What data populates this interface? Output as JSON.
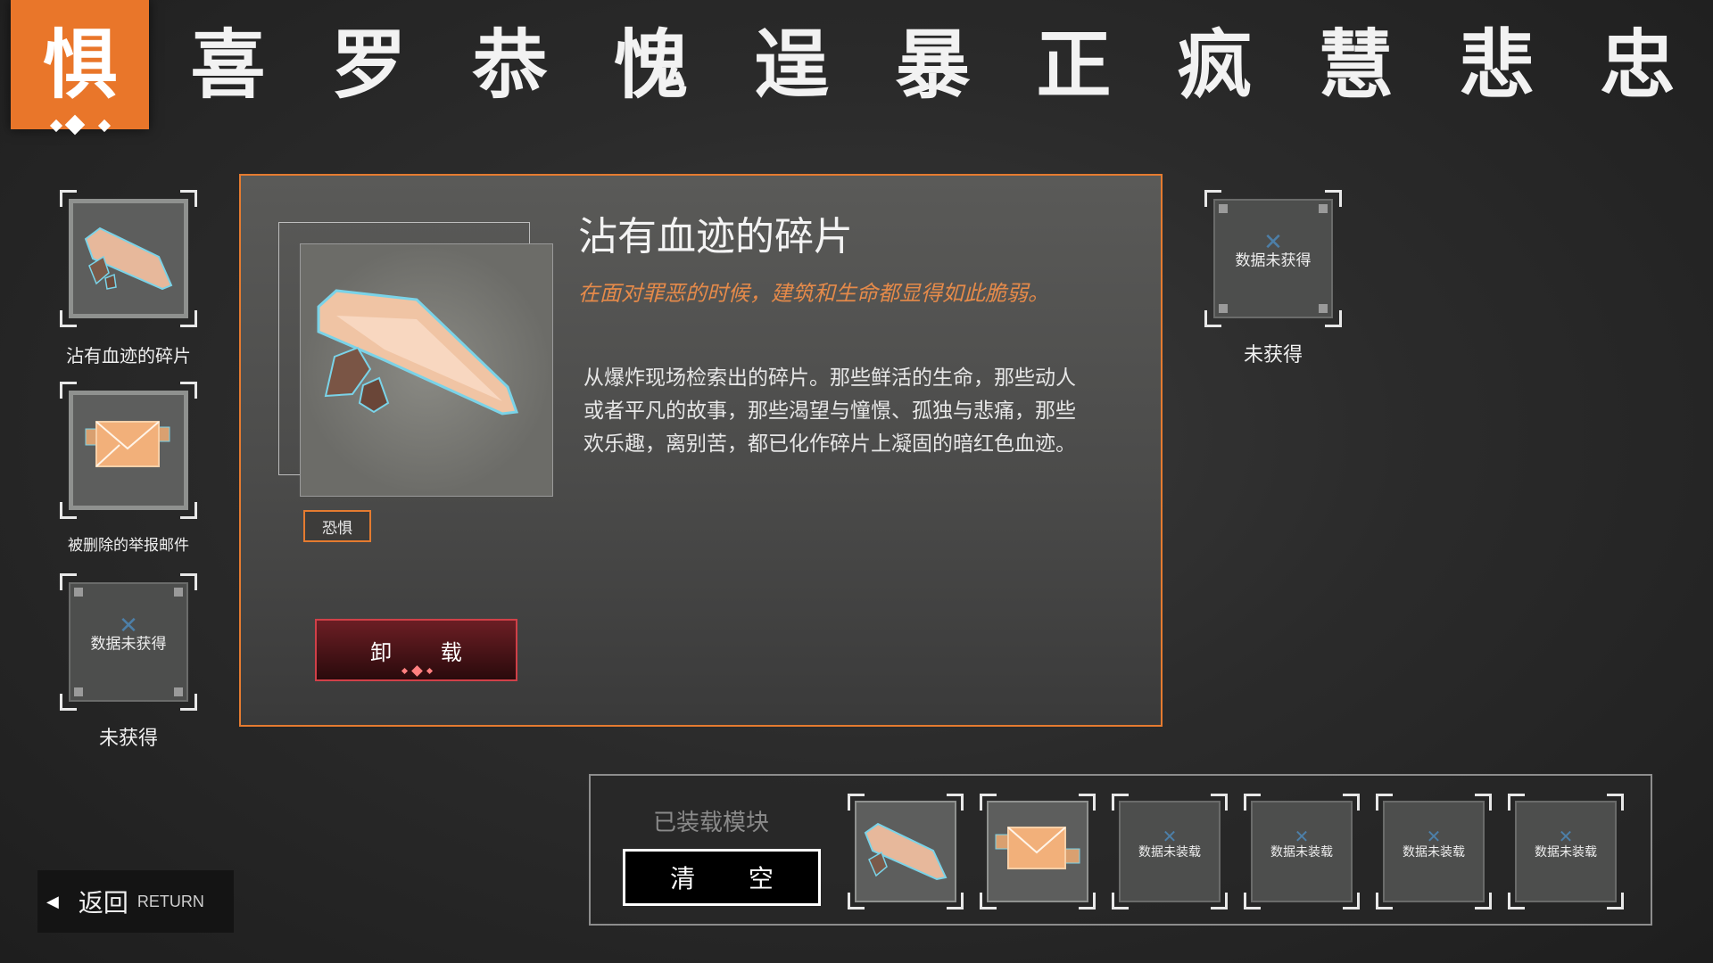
{
  "tabs": [
    {
      "label": "惧",
      "active": true
    },
    {
      "label": "喜",
      "active": false
    },
    {
      "label": "罗",
      "active": false
    },
    {
      "label": "恭",
      "active": false
    },
    {
      "label": "愧",
      "active": false
    },
    {
      "label": "逞",
      "active": false
    },
    {
      "label": "暴",
      "active": false
    },
    {
      "label": "正",
      "active": false
    },
    {
      "label": "疯",
      "active": false
    },
    {
      "label": "慧",
      "active": false
    },
    {
      "label": "悲",
      "active": false
    },
    {
      "label": "忠",
      "active": false
    }
  ],
  "left_slots": [
    {
      "caption": "沾有血迹的碎片",
      "state": "obtained",
      "icon": "shard-icon"
    },
    {
      "caption": "被删除的举报邮件",
      "state": "obtained",
      "icon": "envelope-icon"
    },
    {
      "caption": "未获得",
      "state": "empty",
      "empty_text": "数据未获得"
    }
  ],
  "right_slots": [
    {
      "caption": "未获得",
      "state": "empty",
      "empty_text": "数据未获得"
    }
  ],
  "detail": {
    "title": "沾有血迹的碎片",
    "quote": "在面对罪恶的时候，建筑和生命都显得如此脆弱。",
    "description_lines": [
      "从爆炸现场检索出的碎片。那些鲜活的生命，那些动人",
      "或者平凡的故事，那些渴望与憧憬、孤独与悲痛，那些",
      "欢乐趣，离别苦，都已化作碎片上凝固的暗红色血迹。"
    ],
    "tag": "恐惧",
    "unload_label": "卸 载",
    "icon": "shard-icon"
  },
  "equipped": {
    "title": "已装载模块",
    "clear_label": "清 空",
    "slots": [
      {
        "state": "filled",
        "icon": "shard-icon"
      },
      {
        "state": "filled",
        "icon": "envelope-icon"
      },
      {
        "state": "empty",
        "text": "数据未装载"
      },
      {
        "state": "empty",
        "text": "数据未装载"
      },
      {
        "state": "empty",
        "text": "数据未装载"
      },
      {
        "state": "empty",
        "text": "数据未装载"
      }
    ]
  },
  "return_button": {
    "label_cn": "返回",
    "label_en": "RETURN"
  },
  "colors": {
    "accent": "#e9762a",
    "danger": "#d04048",
    "quote": "#e58a4a"
  }
}
